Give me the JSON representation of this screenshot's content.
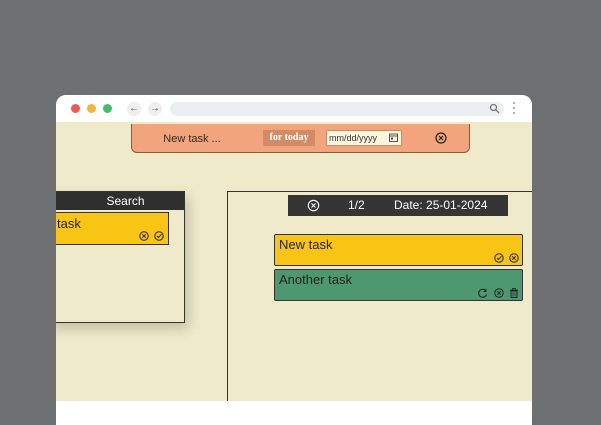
{
  "add_bar": {
    "new_task_placeholder": "New task ...",
    "for_today_label": "for today",
    "date_placeholder": "mm/dd/yyyy",
    "icons": [
      "calendar-icon",
      "close-circle-icon"
    ]
  },
  "search_panel": {
    "header": "Search",
    "result_task": "w task",
    "icons": [
      "close-circle-icon",
      "check-circle-icon"
    ]
  },
  "task_list": {
    "page_indicator": "1/2",
    "date_label": "Date:",
    "date_value": "25-01-2024",
    "tasks": [
      {
        "label": "New task",
        "color": "#f9c515",
        "icons": [
          "check-circle-icon",
          "close-circle-icon"
        ]
      },
      {
        "label": "Another task",
        "color": "#4e9870",
        "icons": [
          "undo-icon",
          "close-circle-icon",
          "trash-icon"
        ]
      }
    ]
  },
  "colors": {
    "background": "#6e6f71",
    "app": "#efeaca",
    "add_bar": "#f2a47c",
    "task_yellow": "#f9c515",
    "task_green": "#4e9870",
    "dark_header": "#353535"
  }
}
